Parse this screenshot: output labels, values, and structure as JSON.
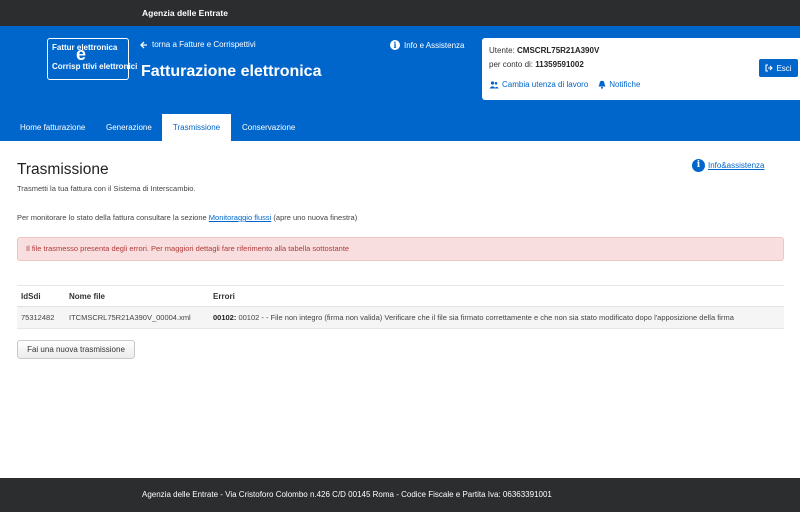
{
  "topbar": {
    "agency": "Agenzia delle Entrate"
  },
  "header": {
    "logo_line1": "Fattur   elettronica",
    "logo_line2": "Corrisp   ttivi  elettronici",
    "logo_mark": "e",
    "back_link": "torna a Fatture e Corrispettivi",
    "app_title": "Fatturazione elettronica",
    "info_link": "Info e Assistenza"
  },
  "user": {
    "user_label": "Utente:",
    "user_value": "CMSCRL75R21A390V",
    "account_label": "per conto di:",
    "account_value": "11359591002",
    "change_user": "Cambia utenza di lavoro",
    "notifications": "Notifiche",
    "exit": "Esci"
  },
  "tabs": [
    {
      "label": "Home fatturazione"
    },
    {
      "label": "Generazione"
    },
    {
      "label": "Trasmissione"
    },
    {
      "label": "Conservazione"
    }
  ],
  "main": {
    "title": "Trasmissione",
    "subtitle": "Trasmetti la tua fattura con il Sistema di Interscambio.",
    "help_link": "Info&assistenza",
    "monitor_prefix": "Per monitorare lo stato della fattura consultare la sezione ",
    "monitor_link": "Monitoraggio flussi",
    "monitor_suffix": " (apre uno nuova finestra)",
    "alert": "Il file trasmesso presenta degli errori. Per maggiori dettagli fare riferimento alla tabella sottostante",
    "new_button": "Fai una nuova trasmissione"
  },
  "table": {
    "headers": [
      "IdSdi",
      "Nome file",
      "Errori"
    ],
    "rows": [
      {
        "idsdi": "75312482",
        "file": "ITCMSCRL75R21A390V_00004.xml",
        "error_code": "00102:",
        "error_text": " 00102 - - File non integro (firma non valida) Verificare che il file sia firmato correttamente e che non sia stato modificato dopo l'apposizione della firma"
      }
    ]
  },
  "footer": {
    "text": "Agenzia delle Entrate - Via Cristoforo Colombo n.426 C/D 00145 Roma - Codice Fiscale e Partita Iva: 06363391001"
  },
  "colors": {
    "brand_blue": "#0066cc",
    "dark_bar": "#2b2d2f",
    "alert_bg": "#f8dede",
    "alert_text": "#b03a3a"
  },
  "icons": {
    "back": "arrow-left-icon",
    "info": "info-circle-icon",
    "users": "users-icon",
    "bell": "bell-icon",
    "exit": "sign-out-icon"
  }
}
